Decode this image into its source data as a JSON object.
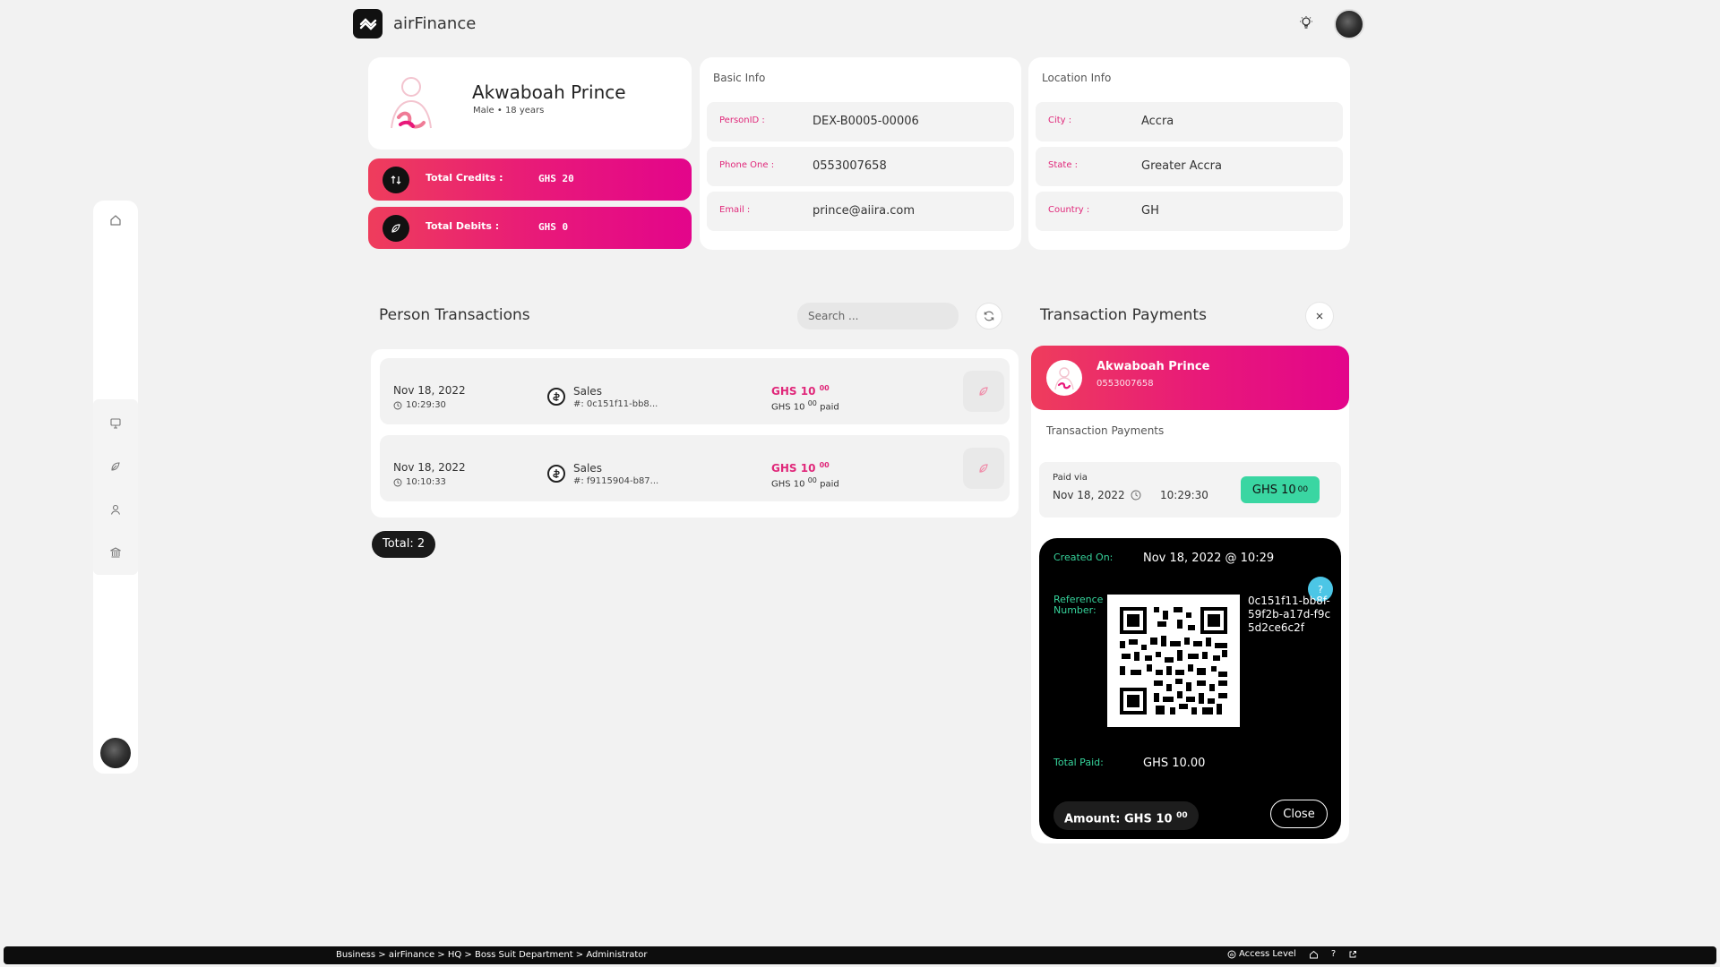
{
  "app": {
    "title": "airFinance"
  },
  "profile": {
    "name": "Akwaboah Prince",
    "sub": "Male • 18 years"
  },
  "stats": [
    {
      "label": "Total Credits :",
      "value": "GHS 20"
    },
    {
      "label": "Total Debits :",
      "value": "GHS 0"
    }
  ],
  "basic_info": {
    "title": "Basic Info",
    "rows": [
      {
        "key": "PersonID :",
        "value": "DEX-B0005-00006"
      },
      {
        "key": "Phone One :",
        "value": "0553007658"
      },
      {
        "key": "Email :",
        "value": "prince@aiira.com"
      }
    ]
  },
  "location_info": {
    "title": "Location Info",
    "rows": [
      {
        "key": "City :",
        "value": "Accra"
      },
      {
        "key": "State :",
        "value": "Greater Accra"
      },
      {
        "key": "Country :",
        "value": "GH"
      }
    ]
  },
  "transactions": {
    "title": "Person Transactions",
    "search_placeholder": "Search ...",
    "rows": [
      {
        "date": "Nov 18, 2022",
        "time": "10:29:30",
        "type": "Sales",
        "ref": "#: 0c151f11-bb8...",
        "amount": "GHS 10",
        "amount_cents": "00",
        "paid": "GHS 10",
        "paid_cents": "00",
        "paid_suffix": "paid"
      },
      {
        "date": "Nov 18, 2022",
        "time": "10:10:33",
        "type": "Sales",
        "ref": "#: f9115904-b87...",
        "amount": "GHS 10",
        "amount_cents": "00",
        "paid": "GHS 10",
        "paid_cents": "00",
        "paid_suffix": "paid"
      }
    ],
    "total": "Total: 2"
  },
  "payments": {
    "title": "Transaction Payments",
    "person_name": "Akwaboah Prince",
    "person_phone": "0553007658",
    "subtitle": "Transaction Payments",
    "paid_via": "Paid via",
    "paid_date": "Nov 18, 2022",
    "paid_time": "10:29:30",
    "paid_amount": "GHS 10",
    "paid_amount_cents": "00",
    "receipt": {
      "created_label": "Created On:",
      "created_value": "Nov 18, 2022 @ 10:29",
      "ref_label_1": "Reference",
      "ref_label_2": "Number:",
      "ref_value": "0c151f11-bb8f-59f2b-a17d-f9c5d2ce6c2f",
      "help": "?",
      "total_label": "Total Paid:",
      "total_value": "GHS 10.00",
      "amount_label": "Amount: GHS 10",
      "amount_cents": "00",
      "close_label": "Close"
    }
  },
  "status_bar": {
    "breadcrumb": "Business > airFinance > HQ > Boss Suit Department > Administrator",
    "access": "Access Level",
    "help": "?"
  },
  "colors": {
    "accent": "#e8187a",
    "accent_start": "#ee3d5c",
    "success": "#3ad6a2",
    "receipt_label": "#36d39b",
    "info": "#4cc6e6"
  }
}
